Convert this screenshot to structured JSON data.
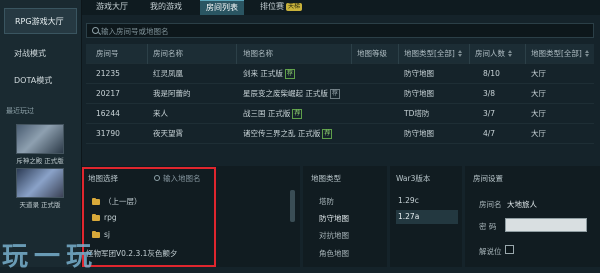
{
  "sidebar": {
    "items": [
      {
        "label": "RPG游戏大厅",
        "active": true
      },
      {
        "label": "对战模式",
        "active": false
      },
      {
        "label": "DOTA模式",
        "active": false
      }
    ],
    "recent_label": "最近玩过",
    "recent_games": [
      {
        "label": "斥神之殿 正式版"
      },
      {
        "label": "天道录 正式版"
      }
    ]
  },
  "tabs": [
    {
      "label": "游戏大厅"
    },
    {
      "label": "我的游戏"
    },
    {
      "label": "房间列表",
      "active": true
    },
    {
      "label": "排位赛",
      "badge": "天梯"
    }
  ],
  "search": {
    "placeholder": "输入房间号或地图名"
  },
  "room_table": {
    "headers": [
      "房间号",
      "房间名称",
      "地图名称",
      "地图等级",
      "地图类型[全部]",
      "房间人数",
      "地图类型[全部]"
    ],
    "rows": [
      {
        "id": "21235",
        "name": "红灵凤凰",
        "map": "剑来 正式版",
        "tag": "荐",
        "tag_style": "green",
        "level": "",
        "type": "防守地图",
        "players": "8/10",
        "hall": "大厅"
      },
      {
        "id": "20217",
        "name": "我是阿蕾的",
        "map": "星辰变之废柴崛起 正式版",
        "tag": "荐",
        "tag_style": "gray",
        "level": "",
        "type": "防守地图",
        "players": "3/8",
        "hall": "大厅"
      },
      {
        "id": "16244",
        "name": "来人",
        "map": "战三国 正式版",
        "tag": "荐",
        "tag_style": "green",
        "level": "",
        "type": "TD塔防",
        "players": "3/7",
        "hall": "大厅"
      },
      {
        "id": "31790",
        "name": "夜天望霄",
        "map": "诸空传三界之乱 正式版",
        "tag": "荐",
        "tag_style": "green",
        "level": "",
        "type": "防守地图",
        "players": "4/7",
        "hall": "大厅"
      }
    ]
  },
  "map_panel": {
    "title": "地图选择",
    "search_placeholder": "输入地图名",
    "items": [
      "（上一层）",
      "rpg",
      "sj",
      "怪物军团V0.2.3.1灰色颤夕"
    ]
  },
  "type_panel": {
    "title": "地图类型",
    "items": [
      "塔防",
      "防守地图",
      "对抗地图",
      "角色地图"
    ],
    "selected_index": 1
  },
  "version_panel": {
    "title": "War3版本",
    "items": [
      "1.29c",
      "1.27a"
    ],
    "selected_index": 1
  },
  "settings_panel": {
    "title": "房间设置",
    "room_name_label": "房间名",
    "room_name_value": "大地旅人",
    "password_label": "密  码",
    "locked_label": "解说位",
    "locked_checked": false
  },
  "watermark": "玩一玩",
  "colors": {
    "accent": "#2a5562",
    "highlight_border": "#e0262e",
    "folder": "#d8a93a",
    "tag_green": "#5fa04a"
  }
}
